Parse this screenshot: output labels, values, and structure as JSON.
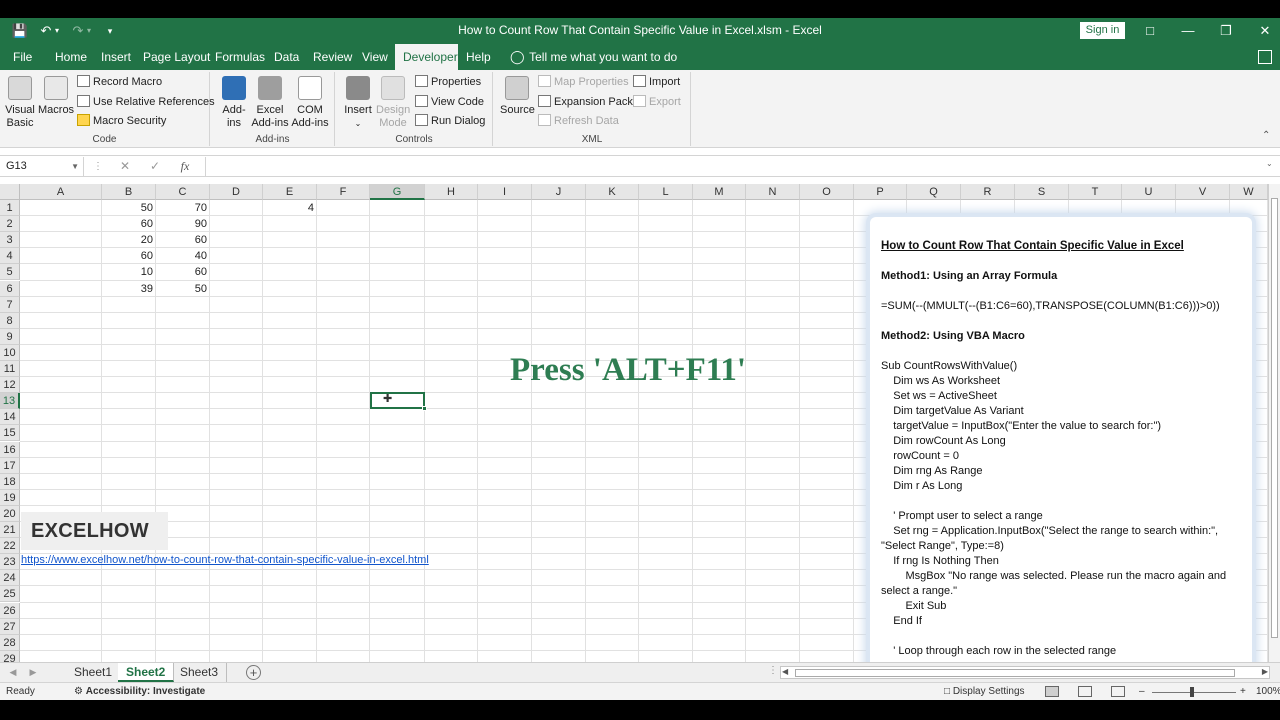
{
  "window": {
    "title": "How to Count Row That Contain Specific Value in Excel.xlsm  -  Excel",
    "sign_in": "Sign in"
  },
  "menu": {
    "tabs": [
      "File",
      "Home",
      "Insert",
      "Page Layout",
      "Formulas",
      "Data",
      "Review",
      "View",
      "Developer",
      "Help"
    ],
    "active_tab": "Developer",
    "tell_me": "Tell me what you want to do"
  },
  "ribbon": {
    "code": {
      "label": "Code",
      "visual_basic": "Visual Basic",
      "macros": "Macros",
      "record_macro": "Record Macro",
      "use_relative": "Use Relative References",
      "macro_security": "Macro Security"
    },
    "addins": {
      "label": "Add-ins",
      "addins": "Add-ins",
      "excel_addins": "Excel Add-ins",
      "com_addins": "COM Add-ins"
    },
    "controls": {
      "label": "Controls",
      "insert": "Insert",
      "design_mode": "Design Mode",
      "properties": "Properties",
      "view_code": "View Code",
      "run_dialog": "Run Dialog"
    },
    "xml": {
      "label": "XML",
      "source": "Source",
      "map_properties": "Map Properties",
      "expansion_packs": "Expansion Packs",
      "refresh_data": "Refresh Data",
      "import": "Import",
      "export": "Export"
    }
  },
  "formula_bar": {
    "name_box": "G13",
    "fx": "fx",
    "formula": ""
  },
  "grid": {
    "columns": [
      "A",
      "B",
      "C",
      "D",
      "E",
      "F",
      "G",
      "H",
      "I",
      "J",
      "K",
      "L",
      "M",
      "N",
      "O",
      "P",
      "Q",
      "R",
      "S",
      "T",
      "U",
      "V",
      "W"
    ],
    "rows": [
      "1",
      "2",
      "3",
      "4",
      "5",
      "6",
      "7",
      "8",
      "9",
      "10",
      "11",
      "12",
      "13",
      "14",
      "15",
      "16",
      "17",
      "18",
      "19",
      "20",
      "21",
      "22",
      "23",
      "24",
      "25",
      "26",
      "27",
      "28",
      "29"
    ],
    "selected_cell": "G13",
    "data": {
      "B": [
        "50",
        "60",
        "20",
        "60",
        "10",
        "39"
      ],
      "C": [
        "70",
        "90",
        "60",
        "40",
        "60",
        "50"
      ],
      "E1": "4"
    },
    "overlay_text": "Press 'ALT+F11'",
    "brand": "EXCELHOW",
    "link": "https://www.excelhow.net/how-to-count-row-that-contain-specific-value-in-excel.html"
  },
  "panel": {
    "title": "How to Count Row That Contain Specific Value in Excel",
    "method1_heading": "Method1: Using an Array Formula",
    "method1_formula": "=SUM(--(MMULT(--(B1:C6=60),TRANSPOSE(COLUMN(B1:C6)))>0))",
    "method2_heading": "Method2: Using VBA Macro",
    "code": "Sub CountRowsWithValue()\n    Dim ws As Worksheet\n    Set ws = ActiveSheet\n    Dim targetValue As Variant\n    targetValue = InputBox(\"Enter the value to search for:\")\n    Dim rowCount As Long\n    rowCount = 0\n    Dim rng As Range\n    Dim r As Long\n\n    ' Prompt user to select a range\n    Set rng = Application.InputBox(\"Select the range to search within:\", \"Select Range\", Type:=8)\n    If rng Is Nothing Then\n        MsgBox \"No range was selected. Please run the macro again and select a range.\"\n        Exit Sub\n    End If\n\n    ' Loop through each row in the selected range"
  },
  "sheets": {
    "tabs": [
      "Sheet1",
      "Sheet2",
      "Sheet3"
    ],
    "active": "Sheet2"
  },
  "status": {
    "ready": "Ready",
    "accessibility": "Accessibility: Investigate",
    "display_settings": "Display Settings",
    "zoom": "100%"
  },
  "colors": {
    "excel_green": "#217346",
    "overlay_text": "#2e7d52",
    "link": "#1155cc"
  }
}
